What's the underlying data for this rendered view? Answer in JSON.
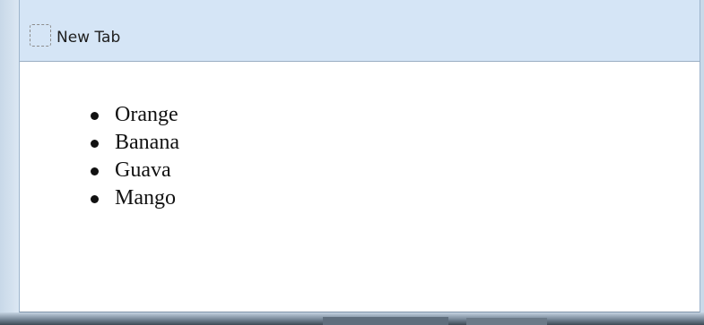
{
  "tab": {
    "title": "New Tab",
    "icon": "blank-page-icon"
  },
  "content": {
    "list_items": [
      "Orange",
      "Banana",
      "Guava",
      "Mango"
    ]
  },
  "colors": {
    "tab_header_bg": "#d5e5f6",
    "content_bg": "#ffffff",
    "text": "#111111"
  }
}
